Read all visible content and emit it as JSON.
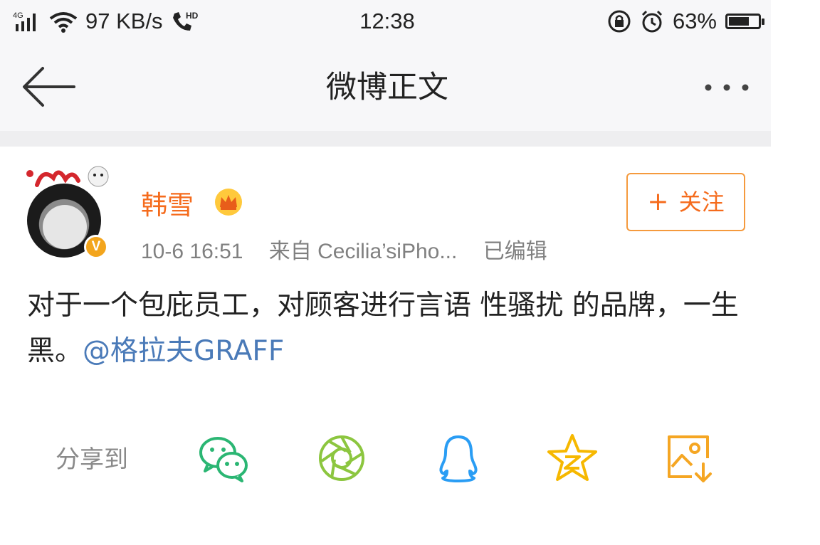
{
  "status_bar": {
    "signal": "4G",
    "speed": "97 KB/s",
    "hd": "HD",
    "time": "12:38",
    "battery": "63%",
    "battery_level": 0.63
  },
  "header": {
    "title": "微博正文"
  },
  "post": {
    "author": "韩雪",
    "timestamp": "10-6 16:51",
    "source": "来自 Cecilia’siPho...",
    "edited": "已编辑",
    "follow_label": "关注",
    "verified_badge": "V",
    "text_main": "对于一个包庇员工，对顾客进行言语 性骚扰 的品牌，一生黑。",
    "mention": "@格拉夫GRAFF"
  },
  "share": {
    "label": "分享到",
    "targets": [
      "wechat-icon",
      "moments-icon",
      "qq-icon",
      "qzone-icon",
      "save-image-icon"
    ]
  },
  "colors": {
    "accent": "#f56b1c",
    "link": "#4a7ab8",
    "wechat": "#2bb673",
    "moments": "#8cc63f",
    "qq": "#2a9df4",
    "qzone": "#f6b800",
    "save": "#f5a623"
  }
}
